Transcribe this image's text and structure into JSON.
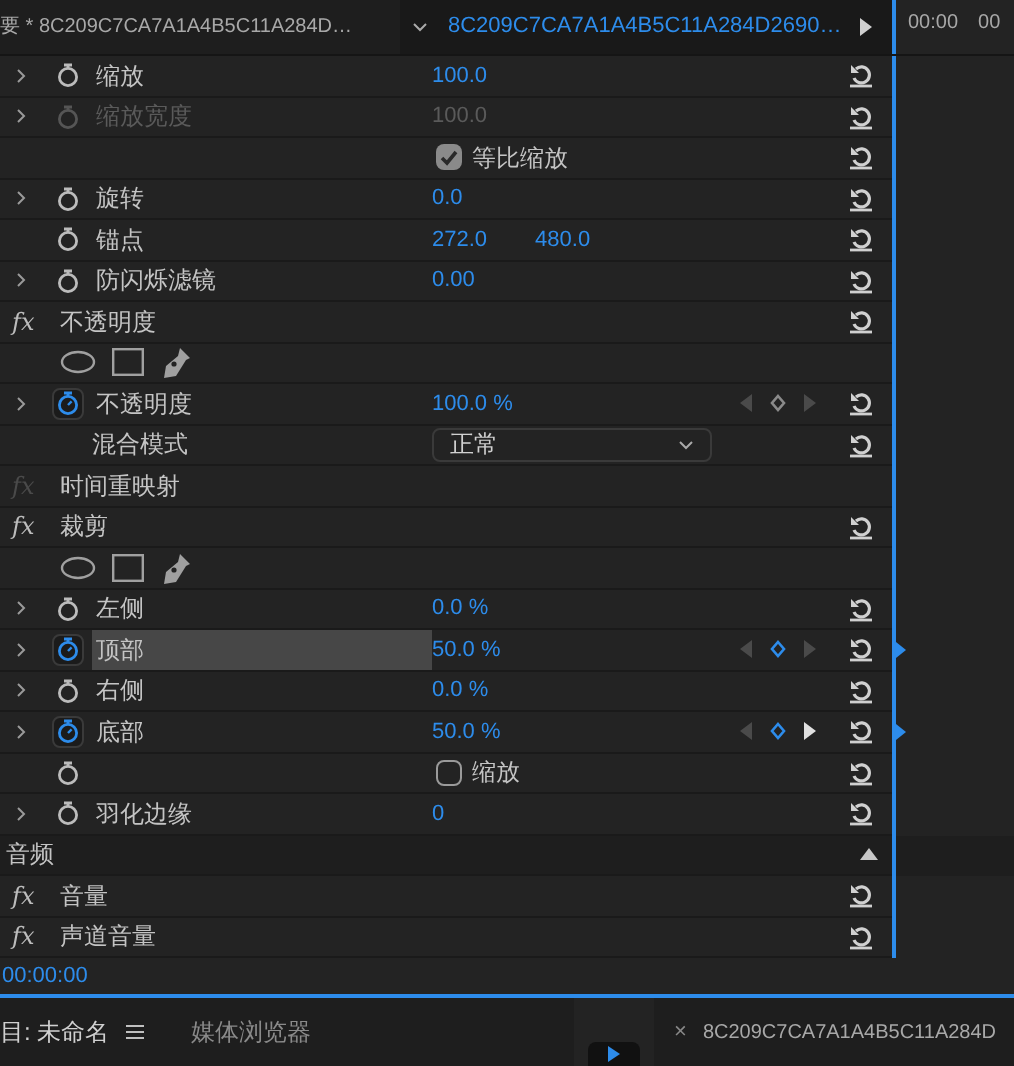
{
  "header": {
    "sequence_tab": "要 * 8C209C7CA7A1A4B5C11A284D…",
    "clip_tab": "8C209C7CA7A1A4B5C11A284D2690…",
    "ruler_times": [
      "00:00",
      "00"
    ]
  },
  "rows": [
    {
      "kind": "param",
      "label": "缩放",
      "expandable": true,
      "animated": false,
      "disabled": false,
      "selected": false,
      "values": [
        "100.0"
      ],
      "resettable": true
    },
    {
      "kind": "param",
      "label": "缩放宽度",
      "expandable": true,
      "animated": false,
      "disabled": true,
      "selected": false,
      "values": [
        "100.0"
      ],
      "resettable": true
    },
    {
      "kind": "checkbox",
      "label": "等比缩放",
      "checked": true,
      "stopwatch": false,
      "resettable": true
    },
    {
      "kind": "param",
      "label": "旋转",
      "expandable": true,
      "animated": false,
      "disabled": false,
      "selected": false,
      "values": [
        "0.0"
      ],
      "resettable": true
    },
    {
      "kind": "param",
      "label": "锚点",
      "expandable": false,
      "animated": false,
      "disabled": false,
      "selected": false,
      "values": [
        "272.0",
        "480.0"
      ],
      "resettable": true
    },
    {
      "kind": "param",
      "label": "防闪烁滤镜",
      "expandable": true,
      "animated": false,
      "disabled": false,
      "selected": false,
      "values": [
        "0.00"
      ],
      "resettable": true
    },
    {
      "kind": "effect",
      "fx": "fx",
      "label": "不透明度",
      "fx_enabled": true,
      "resettable": true
    },
    {
      "kind": "masks"
    },
    {
      "kind": "param",
      "label": "不透明度",
      "expandable": true,
      "animated": true,
      "disabled": false,
      "selected": false,
      "values": [
        "100.0 %"
      ],
      "keyframe_nav": {
        "on_keyframe": false,
        "next_enabled": false
      },
      "resettable": true
    },
    {
      "kind": "dropdown",
      "label": "混合模式",
      "value": "正常",
      "resettable": true
    },
    {
      "kind": "effect",
      "fx": "fx",
      "label": "时间重映射",
      "fx_enabled": false,
      "resettable": false
    },
    {
      "kind": "effect",
      "fx": "fx",
      "label": "裁剪",
      "fx_enabled": true,
      "resettable": true
    },
    {
      "kind": "masks"
    },
    {
      "kind": "param",
      "label": "左侧",
      "expandable": true,
      "animated": false,
      "disabled": false,
      "selected": false,
      "values": [
        "0.0 %"
      ],
      "resettable": true
    },
    {
      "kind": "param",
      "label": "顶部",
      "expandable": true,
      "animated": true,
      "disabled": false,
      "selected": true,
      "values": [
        "50.0 %"
      ],
      "keyframe_nav": {
        "on_keyframe": true,
        "next_enabled": false
      },
      "timeline_marker": true,
      "resettable": true
    },
    {
      "kind": "param",
      "label": "右侧",
      "expandable": true,
      "animated": false,
      "disabled": false,
      "selected": false,
      "values": [
        "0.0 %"
      ],
      "resettable": true
    },
    {
      "kind": "param",
      "label": "底部",
      "expandable": true,
      "animated": true,
      "disabled": false,
      "selected": false,
      "values": [
        "50.0 %"
      ],
      "keyframe_nav": {
        "on_keyframe": true,
        "next_enabled": true
      },
      "timeline_marker": true,
      "resettable": true
    },
    {
      "kind": "checkbox",
      "label": "缩放",
      "checked": false,
      "stopwatch": true,
      "resettable": true
    },
    {
      "kind": "param",
      "label": "羽化边缘",
      "expandable": true,
      "animated": false,
      "disabled": false,
      "selected": false,
      "values": [
        "0"
      ],
      "resettable": true
    },
    {
      "kind": "section",
      "label": "音频",
      "expanded": true
    },
    {
      "kind": "effect",
      "fx": "fx",
      "label": "音量",
      "fx_enabled": true,
      "resettable": true
    },
    {
      "kind": "effect",
      "fx": "fx",
      "label": "声道音量",
      "fx_enabled": true,
      "resettable": true
    }
  ],
  "timecode": "00:00:00",
  "bottom_tabs": [
    {
      "label": "目: 未命名",
      "selected": true,
      "menu": true
    },
    {
      "label": "媒体浏览器",
      "selected": false,
      "menu": false
    }
  ],
  "source_close": "×",
  "source_tab": "8C209C7CA7A1A4B5C11A284D"
}
